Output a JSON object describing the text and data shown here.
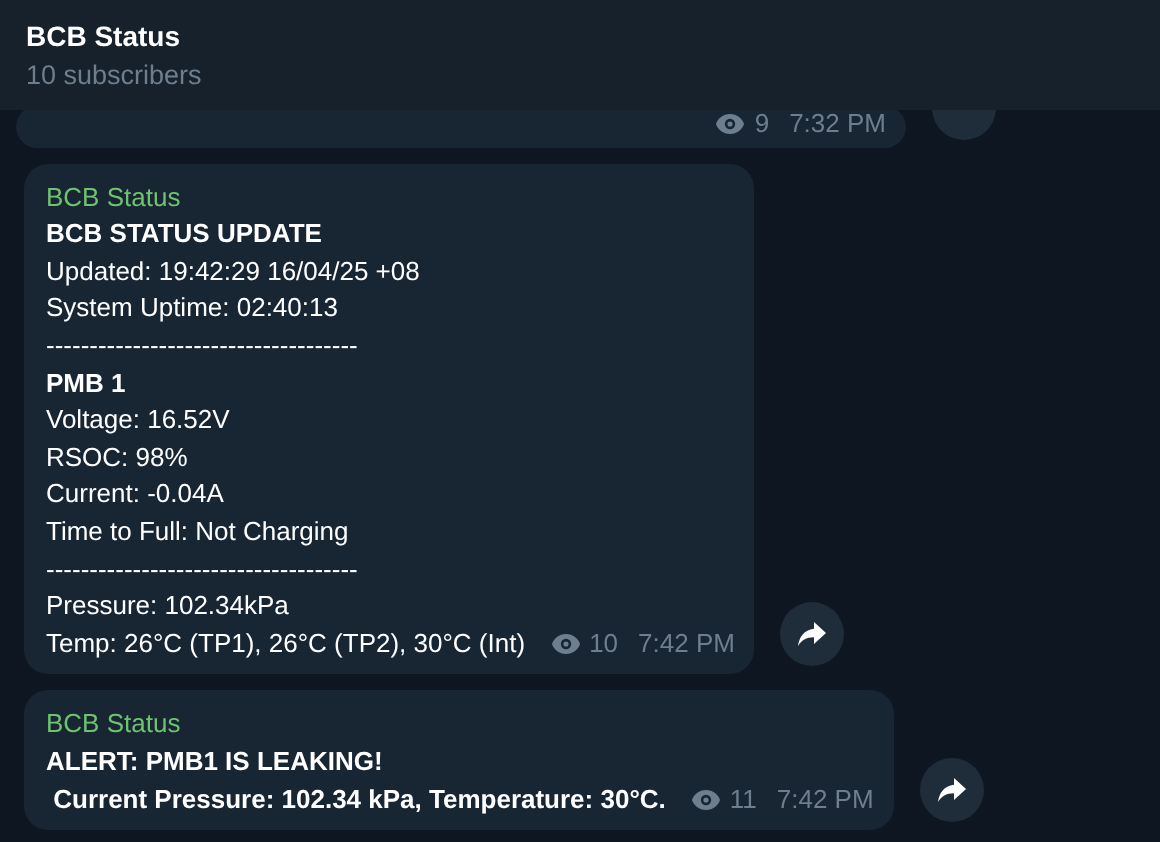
{
  "header": {
    "title": "BCB Status",
    "subtitle": "10 subscribers"
  },
  "messages": [
    {
      "kind": "clipped",
      "views": "9",
      "time": "7:32 PM"
    },
    {
      "kind": "full",
      "sender": "BCB Status",
      "lines": [
        {
          "text": "BCB STATUS UPDATE",
          "bold": true
        },
        {
          "text": "Updated: 19:42:29 16/04/25 +08",
          "bold": false
        },
        {
          "text": "System Uptime: 02:40:13",
          "bold": false
        },
        {
          "text": "------------------------------------",
          "bold": false
        },
        {
          "text": "PMB 1",
          "bold": true
        },
        {
          "text": "Voltage: 16.52V",
          "bold": false
        },
        {
          "text": "RSOC: 98%",
          "bold": false
        },
        {
          "text": "Current: -0.04A",
          "bold": false
        },
        {
          "text": "Time to Full: Not Charging",
          "bold": false
        },
        {
          "text": "------------------------------------",
          "bold": false
        },
        {
          "text": "Pressure: 102.34kPa",
          "bold": false
        },
        {
          "text": "Temp: 26°C (TP1), 26°C (TP2), 30°C (Int)",
          "bold": false
        }
      ],
      "views": "10",
      "time": "7:42 PM"
    },
    {
      "kind": "full",
      "sender": "BCB Status",
      "lines": [
        {
          "text": "ALERT: PMB1 IS LEAKING!",
          "bold": true
        },
        {
          "text": " Current Pressure: 102.34 kPa, Temperature: 30°C.",
          "bold": true
        }
      ],
      "views": "11",
      "time": "7:42 PM"
    }
  ]
}
